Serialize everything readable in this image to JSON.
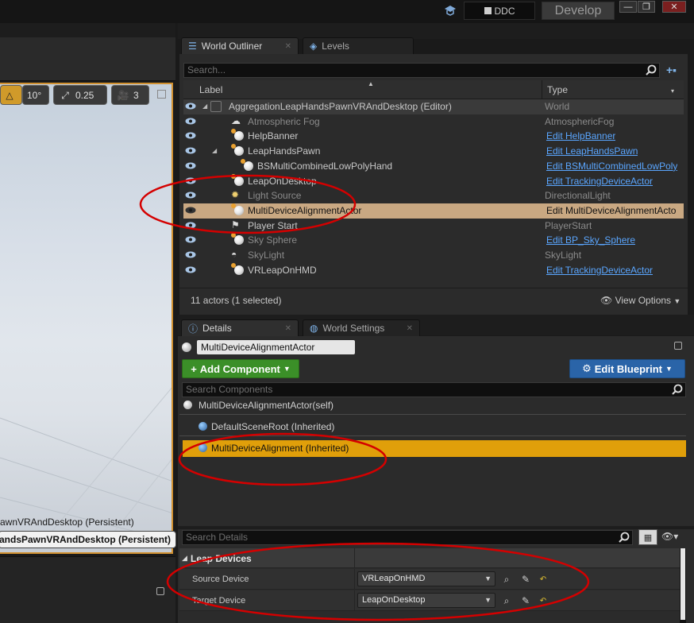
{
  "topbar": {
    "ddc_label": "DDC",
    "develop_label": "Develop",
    "minimize": "—",
    "restore": "❐",
    "close": "✕"
  },
  "viewport": {
    "angle_snap": "10°",
    "scale_snap": "0.25",
    "camera_speed": "3",
    "level_text": "awnVRAndDesktop (Persistent)",
    "level_button": "andsPawnVRAndDesktop (Persistent)"
  },
  "outliner": {
    "tabs": [
      {
        "label": "World Outliner"
      },
      {
        "label": "Levels"
      }
    ],
    "search_placeholder": "Search...",
    "col_label": "Label",
    "col_type": "Type",
    "rows": [
      {
        "label": "AggregationLeapHandsPawnVRAndDesktop (Editor)",
        "type": "World"
      },
      {
        "label": "Atmospheric Fog",
        "type": "AtmosphericFog"
      },
      {
        "label": "HelpBanner",
        "type": "Edit HelpBanner"
      },
      {
        "label": "LeapHandsPawn",
        "type": "Edit LeapHandsPawn"
      },
      {
        "label": "BSMultiCombinedLowPolyHand",
        "type": "Edit BSMultiCombinedLowPoly"
      },
      {
        "label": "LeapOnDesktop",
        "type": "Edit TrackingDeviceActor"
      },
      {
        "label": "Light Source",
        "type": "DirectionalLight"
      },
      {
        "label": "MultiDeviceAlignmentActor",
        "type": "Edit MultiDeviceAlignmentActo"
      },
      {
        "label": "Player Start",
        "type": "PlayerStart"
      },
      {
        "label": "Sky Sphere",
        "type": "Edit BP_Sky_Sphere"
      },
      {
        "label": "SkyLight",
        "type": "SkyLight"
      },
      {
        "label": "VRLeapOnHMD",
        "type": "Edit TrackingDeviceActor"
      }
    ],
    "footer_count": "11 actors (1 selected)",
    "view_options": "View Options"
  },
  "details": {
    "tabs": [
      {
        "label": "Details"
      },
      {
        "label": "World Settings"
      }
    ],
    "actor_name": "MultiDeviceAlignmentActor",
    "add_component": "Add Component",
    "edit_blueprint": "Edit Blueprint",
    "search_components_placeholder": "Search Components",
    "components": [
      {
        "label": "MultiDeviceAlignmentActor(self)"
      },
      {
        "label": "DefaultSceneRoot (Inherited)"
      },
      {
        "label": "MultiDeviceAlignment (Inherited)"
      }
    ],
    "search_details_placeholder": "Search Details",
    "category": "Leap Devices",
    "properties": [
      {
        "name": "Source Device",
        "value": "VRLeapOnHMD"
      },
      {
        "name": "Target Device",
        "value": "LeapOnDesktop"
      }
    ]
  },
  "colors": {
    "selection_row": "#c9a882",
    "selected_component": "#e09f0a",
    "link": "#5aa6ff",
    "annotation": "#d40000"
  }
}
